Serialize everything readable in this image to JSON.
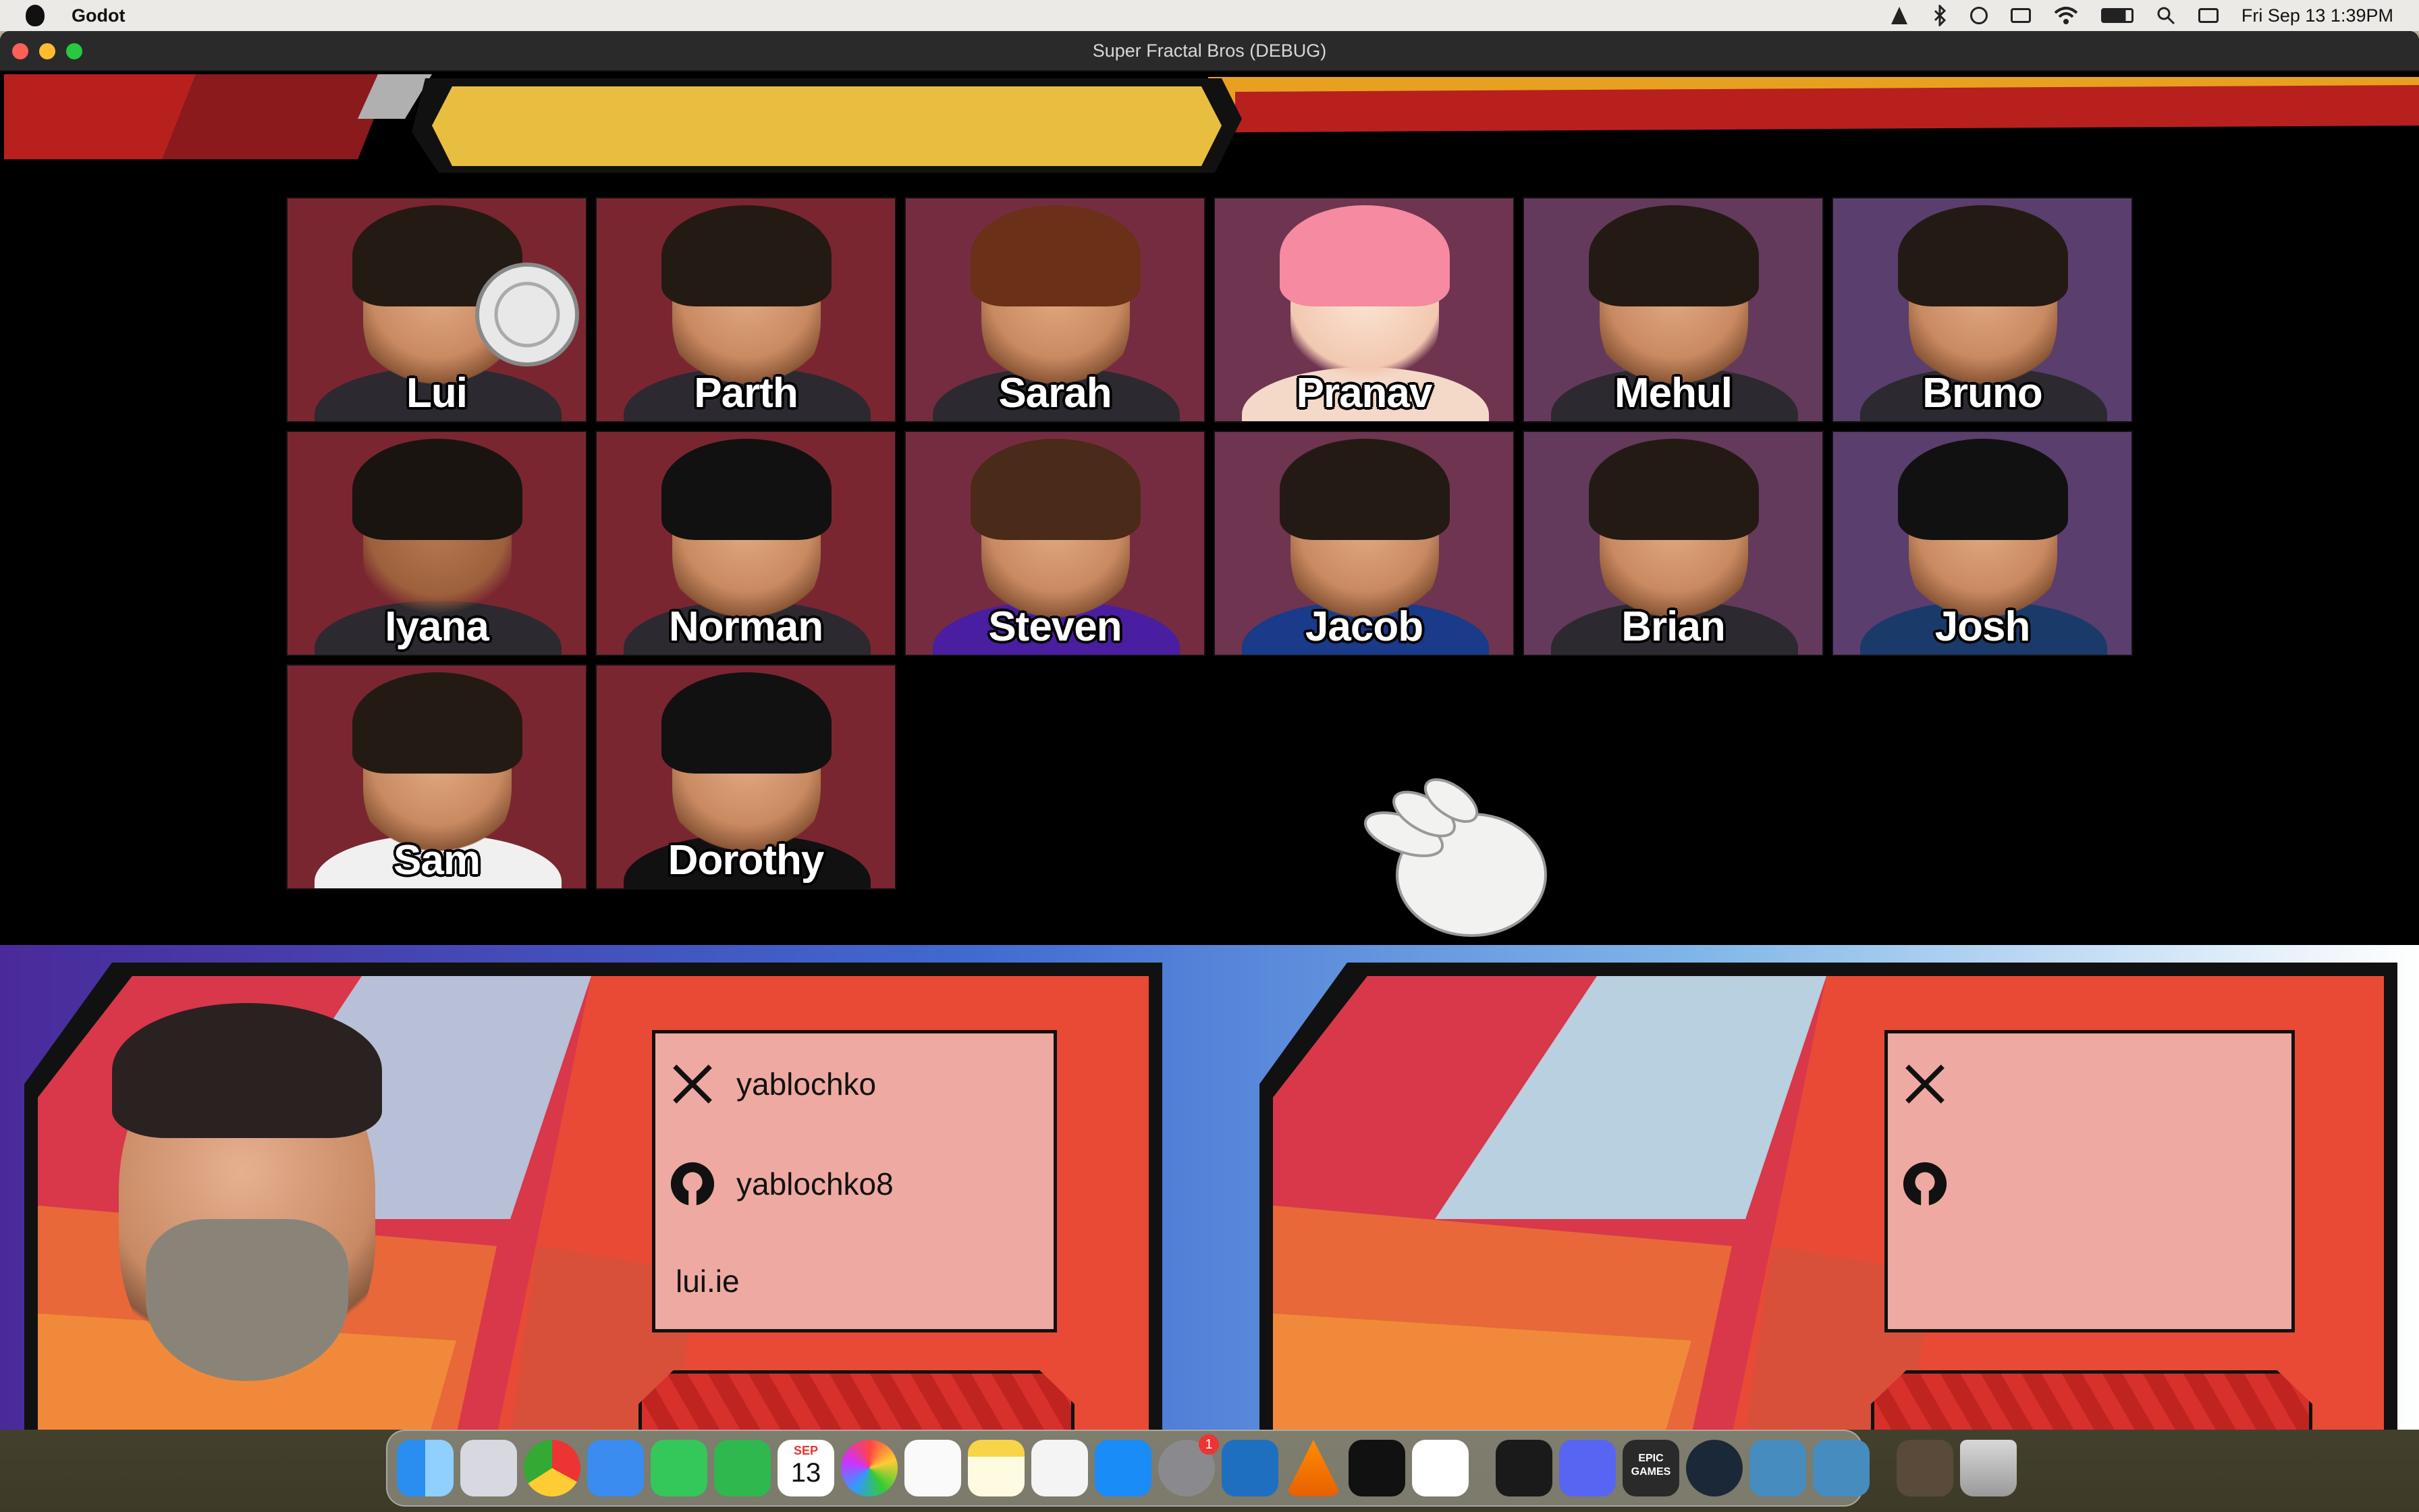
{
  "menubar": {
    "app_name": "Godot",
    "datetime": "Fri Sep 13  1:39PM"
  },
  "window": {
    "title": "Super Fractal Bros (DEBUG)"
  },
  "roster": [
    {
      "name": "Lui",
      "bg": "#7a2630"
    },
    {
      "name": "Parth",
      "bg": "#7a2630"
    },
    {
      "name": "Sarah",
      "bg": "#762c40"
    },
    {
      "name": "Pranav",
      "bg": "#6e3450"
    },
    {
      "name": "Mehul",
      "bg": "#633a5c"
    },
    {
      "name": "Bruno",
      "bg": "#5a3e6e"
    },
    {
      "name": "Iyana",
      "bg": "#7a2630"
    },
    {
      "name": "Norman",
      "bg": "#7a2630"
    },
    {
      "name": "Steven",
      "bg": "#762c40"
    },
    {
      "name": "Jacob",
      "bg": "#6e3450"
    },
    {
      "name": "Brian",
      "bg": "#633a5c"
    },
    {
      "name": "Josh",
      "bg": "#5a3e6e"
    },
    {
      "name": "Sam",
      "bg": "#7a2630"
    },
    {
      "name": "Dorothy",
      "bg": "#7a2630"
    }
  ],
  "player1": {
    "twitter": "yablochko",
    "github": "yablochko8",
    "website": "lui.ie"
  },
  "player2": {
    "twitter": "",
    "github": "",
    "website": ""
  },
  "colors": {
    "banner_yellow": "#e8be40",
    "banner_red": "#b8201e",
    "info_pink": "#eeaaa2",
    "panel_red": "#e84a36"
  },
  "dock": {
    "apps": [
      "finder",
      "launchpad",
      "chrome",
      "mail",
      "messages",
      "facetime",
      "calendar",
      "photos",
      "reminders",
      "notes",
      "freeform",
      "app-store",
      "system-settings",
      "vscode",
      "vlc",
      "terminal",
      "slack",
      "terminal-2",
      "discord",
      "epic-games",
      "steam",
      "godot",
      "godot-2",
      "photo-app",
      "trash"
    ],
    "calendar_month": "SEP",
    "calendar_day": "13",
    "settings_badge": "1",
    "epic_label": "EPIC GAMES"
  }
}
